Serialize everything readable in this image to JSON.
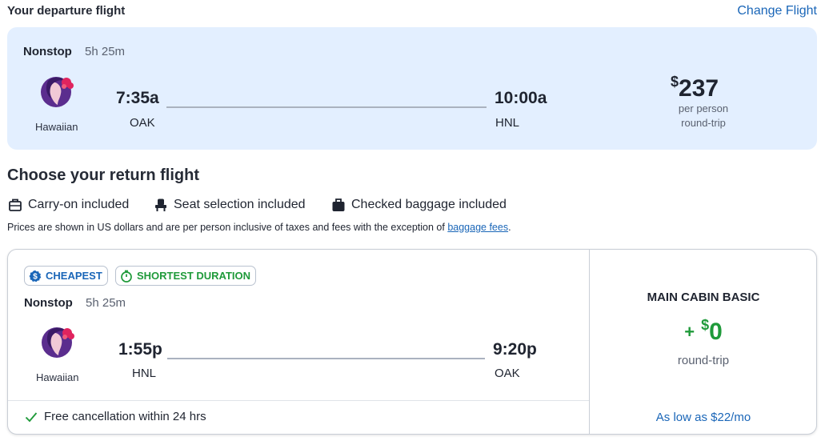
{
  "departure": {
    "title": "Your departure flight",
    "change_link": "Change Flight",
    "nonstop": "Nonstop",
    "duration": "5h 25m",
    "airline": "Hawaiian",
    "depart_time": "7:35a",
    "depart_code": "OAK",
    "arrive_time": "10:00a",
    "arrive_code": "HNL",
    "price_currency": "$",
    "price_amount": "237",
    "price_per": "per person",
    "price_type": "round-trip"
  },
  "return_section": {
    "title": "Choose your return flight",
    "features": [
      {
        "icon": "carry-on-bag-icon",
        "label": "Carry-on included"
      },
      {
        "icon": "seat-icon",
        "label": "Seat selection included"
      },
      {
        "icon": "checked-bag-icon",
        "label": "Checked baggage included"
      }
    ],
    "disclaimer_text": "Prices are shown in US dollars and are per person inclusive of taxes and fees with the exception of ",
    "disclaimer_link": "baggage fees",
    "disclaimer_end": "."
  },
  "return_flight": {
    "badges": [
      {
        "icon": "dollar-icon",
        "label": "CHEAPEST",
        "color": "#1a66b8"
      },
      {
        "icon": "stopwatch-icon",
        "label": "SHORTEST DURATION",
        "color": "#1f9a3a"
      }
    ],
    "nonstop": "Nonstop",
    "duration": "5h 25m",
    "airline": "Hawaiian",
    "depart_time": "1:55p",
    "depart_code": "HNL",
    "arrive_time": "9:20p",
    "arrive_code": "OAK",
    "free_cancellation": "Free cancellation within 24 hrs",
    "cabin": "MAIN CABIN BASIC",
    "addon_plus": "+",
    "addon_currency": "$",
    "addon_amount": "0",
    "addon_type": "round-trip",
    "financing": "As low as $22/mo"
  },
  "colors": {
    "accent_blue": "#1a66b8",
    "accent_green": "#1f9a3a",
    "card_bg": "#e3efff",
    "hawaiian_purple": "#5b2d8e",
    "hawaiian_red": "#e0245e"
  }
}
